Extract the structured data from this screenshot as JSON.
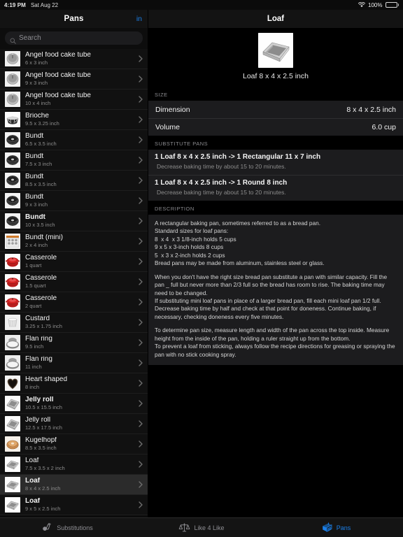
{
  "status_bar": {
    "time": "4:19 PM",
    "date": "Sat Aug 22",
    "battery_percent": "100%",
    "wifi_icon": "wifi-icon",
    "battery_icon": "battery-icon"
  },
  "sidebar": {
    "title": "Pans",
    "edit_label": "in",
    "search": {
      "placeholder": "Search",
      "value": "",
      "icon": "search-icon"
    },
    "items": [
      {
        "title": "Angel food cake tube",
        "sub": "6 x 3 inch",
        "icon": "tube-pan-icon",
        "selected": false,
        "bold": false
      },
      {
        "title": "Angel food cake tube",
        "sub": "9 x 3 inch",
        "icon": "tube-pan-icon",
        "selected": false,
        "bold": false
      },
      {
        "title": "Angel food cake tube",
        "sub": "10 x 4 inch",
        "icon": "tube-pan-icon",
        "selected": false,
        "bold": false
      },
      {
        "title": "Brioche",
        "sub": "9.5 x 3.25 inch",
        "icon": "brioche-pan-icon",
        "selected": false,
        "bold": false
      },
      {
        "title": "Bundt",
        "sub": "6.5 x 3.5 inch",
        "icon": "bundt-pan-icon",
        "selected": false,
        "bold": false
      },
      {
        "title": "Bundt",
        "sub": "7.5 x 3 inch",
        "icon": "bundt-pan-icon",
        "selected": false,
        "bold": false
      },
      {
        "title": "Bundt",
        "sub": "8.5 x 3.5 inch",
        "icon": "bundt-pan-icon",
        "selected": false,
        "bold": false
      },
      {
        "title": "Bundt",
        "sub": "9 x 3 inch",
        "icon": "bundt-pan-icon",
        "selected": false,
        "bold": false
      },
      {
        "title": "Bundt",
        "sub": "10 x 3.5 inch",
        "icon": "bundt-pan-icon",
        "selected": false,
        "bold": true
      },
      {
        "title": "Bundt (mini)",
        "sub": "2 x 4 inch",
        "icon": "mini-bundt-pan-icon",
        "selected": false,
        "bold": false
      },
      {
        "title": "Casserole",
        "sub": "1 quart",
        "icon": "casserole-icon",
        "selected": false,
        "bold": false
      },
      {
        "title": "Casserole",
        "sub": "1.5 quart",
        "icon": "casserole-icon",
        "selected": false,
        "bold": false
      },
      {
        "title": "Casserole",
        "sub": "2 quart",
        "icon": "casserole-icon",
        "selected": false,
        "bold": false
      },
      {
        "title": "Custard",
        "sub": "3.25 x 1.75 inch",
        "icon": "custard-cup-icon",
        "selected": false,
        "bold": false
      },
      {
        "title": "Flan ring",
        "sub": "9.5 inch",
        "icon": "flan-ring-icon",
        "selected": false,
        "bold": false
      },
      {
        "title": "Flan ring",
        "sub": "11 inch",
        "icon": "flan-ring-icon",
        "selected": false,
        "bold": false
      },
      {
        "title": "Heart shaped",
        "sub": "8 inch",
        "icon": "heart-pan-icon",
        "selected": false,
        "bold": false
      },
      {
        "title": "Jelly roll",
        "sub": "10.5 x 15.5 inch",
        "icon": "jelly-roll-pan-icon",
        "selected": false,
        "bold": true
      },
      {
        "title": "Jelly roll",
        "sub": "12.5 x 17.5 inch",
        "icon": "jelly-roll-pan-icon",
        "selected": false,
        "bold": false
      },
      {
        "title": "Kugelhopf",
        "sub": "8.5 x 3.5 inch",
        "icon": "kugelhopf-pan-icon",
        "selected": false,
        "bold": false
      },
      {
        "title": "Loaf",
        "sub": "7.5 x 3.5 x 2 inch",
        "icon": "loaf-pan-icon",
        "selected": false,
        "bold": false
      },
      {
        "title": "Loaf",
        "sub": "8 x 4 x 2.5 inch",
        "icon": "loaf-pan-icon",
        "selected": true,
        "bold": true
      },
      {
        "title": "Loaf",
        "sub": "9 x 5 x 2.5 inch",
        "icon": "loaf-pan-icon",
        "selected": false,
        "bold": true
      }
    ]
  },
  "detail": {
    "title": "Loaf",
    "hero_caption": "Loaf 8 x 4 x 2.5 inch",
    "hero_icon": "loaf-pan-icon",
    "size_section": {
      "header": "SIZE",
      "rows": [
        {
          "label": "Dimension",
          "value": "8 x 4 x 2.5 inch"
        },
        {
          "label": "Volume",
          "value": "6.0 cup"
        }
      ]
    },
    "substitute_section": {
      "header": "SUBSTITUTE PANS",
      "items": [
        {
          "main": "1 Loaf 8 x 4 x 2.5 inch -> 1 Rectangular 11 x 7 inch",
          "note": "Decrease baking time by about 15 to 20 minutes."
        },
        {
          "main": "1 Loaf 8 x 4 x 2.5 inch -> 1 Round 8 inch",
          "note": "Decrease baking time by about 15 to 20 minutes."
        }
      ]
    },
    "description_section": {
      "header": "DESCRIPTION",
      "paragraphs": [
        "A rectangular baking pan, sometimes referred to as a bread pan.\nStandard sizes for loaf pans:\n8  x 4  x 3 1/8-inch holds 5 cups\n9 x 5 x 3-inch holds 8 cups\n5  x 3 x 2-inch holds 2 cups\nBread pans may be made from aluminum, stainless steel or glass.",
        "When you don't have the right size bread pan substitute a pan with similar capacity. Fill the pan _ full but never more than 2/3 full so the bread has room to rise. The baking time may need to be changed.\nIf substituting mini loaf pans in place of a larger bread pan, fill each mini loaf pan 1/2 full. Decrease baking time by half and check at that point for doneness. Continue baking, if necessary, checking doneness every five minutes.",
        "To determine pan size, measure length and width of the pan across the top inside. Measure height from the inside of the pan, holding a ruler straight up from the bottom.\nTo prevent a loaf from sticking, always follow the recipe directions for greasing or spraying the pan with no stick cooking spray."
      ]
    }
  },
  "tab_bar": {
    "tabs": [
      {
        "label": "Substitutions",
        "icon": "substitutions-icon",
        "active": false
      },
      {
        "label": "Like 4 Like",
        "icon": "scale-balance-icon",
        "active": false
      },
      {
        "label": "Pans",
        "icon": "pans-icon",
        "active": true
      }
    ]
  },
  "colors": {
    "accent": "#1a7fe8",
    "card": "#1c1c1e",
    "selected_row": "#2b2b2b"
  }
}
